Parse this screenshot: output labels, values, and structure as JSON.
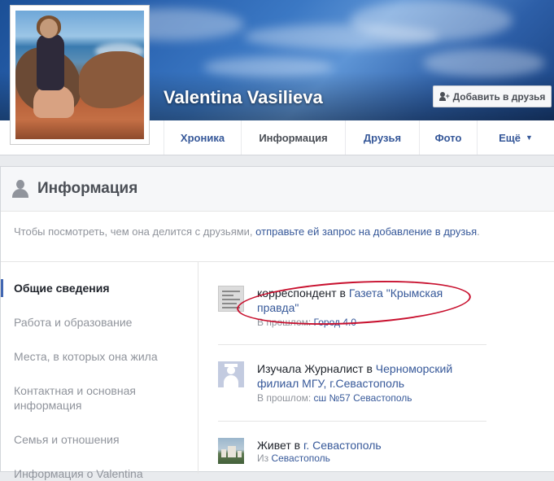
{
  "profile": {
    "name": "Valentina Vasilieva",
    "add_friend_label": "Добавить в друзья"
  },
  "tabs": [
    {
      "label": "Хроника"
    },
    {
      "label": "Информация"
    },
    {
      "label": "Друзья"
    },
    {
      "label": "Фото"
    },
    {
      "label": "Ещё"
    }
  ],
  "section": {
    "title": "Информация",
    "notice_text": "Чтобы посмотреть, чем она делится с друзьями, ",
    "notice_link": "отправьте ей запрос на добавление в друзья",
    "notice_end": "."
  },
  "sidenav": [
    {
      "label": "Общие сведения"
    },
    {
      "label": "Работа и образование"
    },
    {
      "label": "Места, в которых она жила"
    },
    {
      "label": "Контактная и основная информация"
    },
    {
      "label": "Семья и отношения"
    },
    {
      "label": "Информация о Valentina"
    }
  ],
  "entries": {
    "work": {
      "prefix": "корреспондент в ",
      "link": "Газета \"Крымская правда\"",
      "sub_prefix": "В прошлом: ",
      "sub_link": "Город 4.0"
    },
    "education": {
      "prefix": "Изучала Журналист в ",
      "link": "Черноморский филиал МГУ, г.Севастополь",
      "sub_prefix": "В прошлом: ",
      "sub_link": "сш №57 Севастополь"
    },
    "lives": {
      "prefix": "Живет в ",
      "link": "г. Севастополь",
      "sub_prefix": "Из ",
      "sub_link": "Севастополь"
    }
  },
  "icons": {
    "add_friend": "add-friend-icon",
    "section": "user-icon",
    "more_caret": "caret-down-icon"
  }
}
